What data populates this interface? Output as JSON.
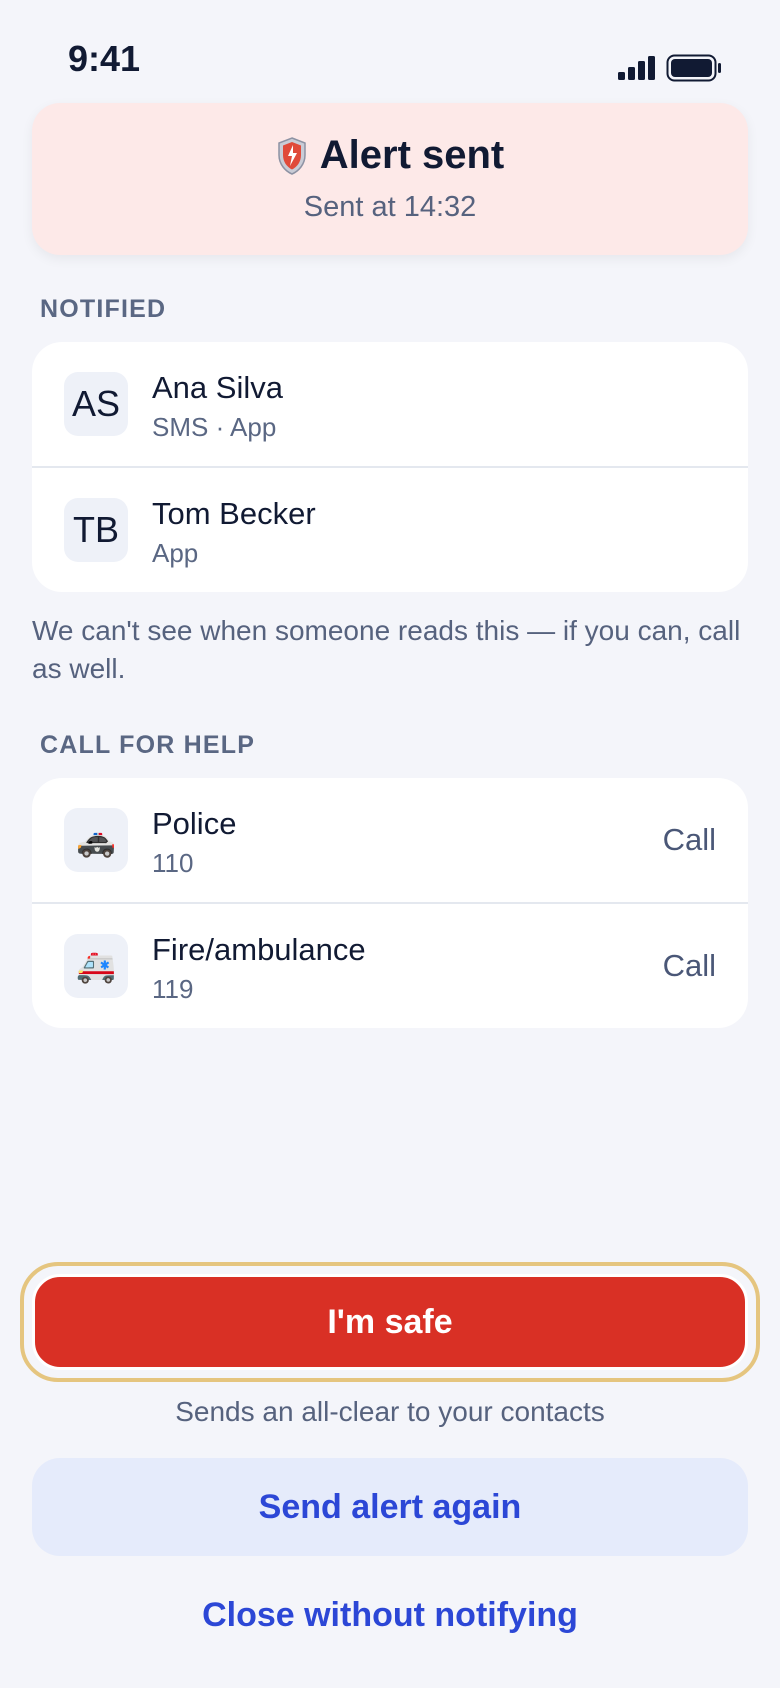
{
  "status_bar": {
    "time": "9:41"
  },
  "alert": {
    "icon": "shield-alert-icon",
    "title": "Alert sent",
    "subtitle": "Sent at 14:32",
    "bg_color": "#fde9e8"
  },
  "notified": {
    "label": "NOTIFIED",
    "contacts": [
      {
        "initials": "AS",
        "name": "Ana Silva",
        "channels": "SMS · App"
      },
      {
        "initials": "TB",
        "name": "Tom Becker",
        "channels": "App"
      }
    ]
  },
  "note": "We can't see when someone reads this — if you can, call as well.",
  "call_for_help": {
    "label": "CALL FOR HELP",
    "services": [
      {
        "icon": "police-car-icon",
        "emoji": "🚓",
        "name": "Police",
        "number": "110",
        "action": "Call"
      },
      {
        "icon": "ambulance-icon",
        "emoji": "🚑",
        "name": "Fire/ambulance",
        "number": "119",
        "action": "Call"
      }
    ]
  },
  "actions": {
    "safe_label": "I'm safe",
    "safe_hint": "Sends an all-clear to your contacts",
    "again_label": "Send alert again",
    "close_label": "Close without notifying"
  },
  "colors": {
    "primary_red": "#d93025",
    "link_blue": "#2c47d6",
    "focus_ring": "#e5c57f",
    "background": "#f4f5fa"
  }
}
